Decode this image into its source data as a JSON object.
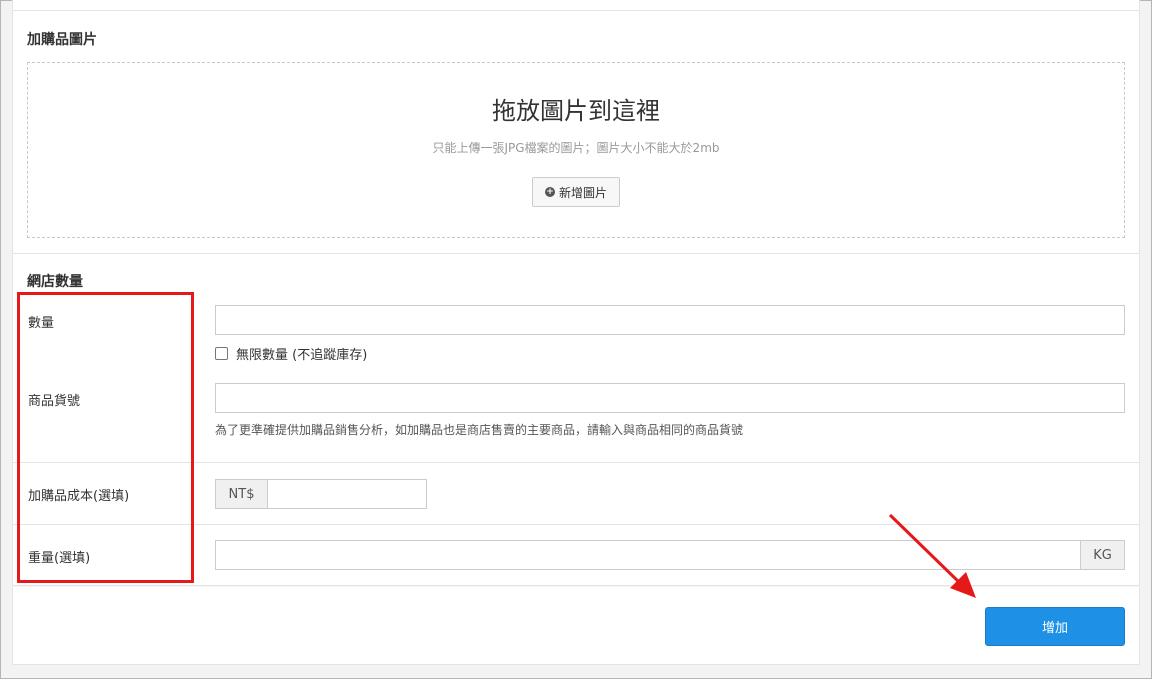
{
  "image_section": {
    "title": "加購品圖片",
    "dropzone_title": "拖放圖片到這裡",
    "dropzone_hint": "只能上傳一張JPG檔案的圖片；圖片大小不能大於2mb",
    "add_image_label": "新增圖片"
  },
  "stock_section": {
    "title": "網店數量",
    "quantity_label": "數量",
    "quantity_value": "",
    "unlimited_label": "無限數量 (不追蹤庫存)",
    "unlimited_checked": false,
    "sku_label": "商品貨號",
    "sku_value": "",
    "sku_help": "為了更準確提供加購品銷售分析，如加購品也是商店售賣的主要商品，請輸入與商品相同的商品貨號",
    "cost_label": "加購品成本(選填)",
    "cost_prefix": "NT$",
    "cost_value": "",
    "weight_label": "重量(選填)",
    "weight_value": "",
    "weight_suffix": "KG"
  },
  "actions": {
    "submit_label": "增加"
  },
  "annotations": {
    "highlight_color": "#e5181a",
    "arrow_color": "#e5181a"
  },
  "colors": {
    "primary_button": "#1e90e6"
  }
}
